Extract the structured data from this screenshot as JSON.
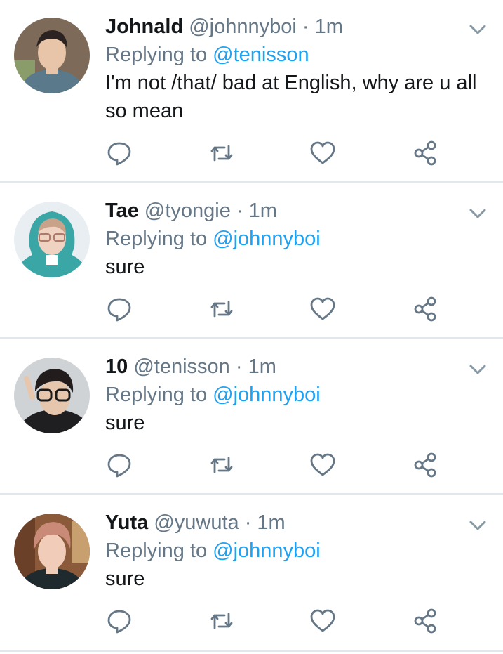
{
  "tweets": [
    {
      "name": "Johnald",
      "handle": "@johnnyboi",
      "sep": " · ",
      "time": "1m",
      "replying_prefix": "Replying to ",
      "replying_to": "@tenisson",
      "text_lines": [
        "I'm not /that/ bad at English, why are u all",
        "so mean"
      ],
      "avatar": {
        "skin": "#e8c4a8",
        "hair": "#2b2222",
        "shirt": "#5a7a8c",
        "bg": "#7d6a58"
      }
    },
    {
      "name": "Tae",
      "handle": "@tyongie",
      "sep": " · ",
      "time": "1m",
      "replying_prefix": "Replying to ",
      "replying_to": "@johnnyboi",
      "text_lines": [
        "sure"
      ],
      "avatar": {
        "skin": "#f0d2c2",
        "hair": "#c9a28a",
        "shirt": "#3aa6a6",
        "bg": "#e9eef2"
      }
    },
    {
      "name": "10",
      "handle": "@tenisson",
      "sep": " · ",
      "time": "1m",
      "replying_prefix": "Replying to ",
      "replying_to": "@johnnyboi",
      "text_lines": [
        "sure"
      ],
      "avatar": {
        "skin": "#e6c6ad",
        "hair": "#221c1c",
        "shirt": "#1f1f22",
        "bg": "#cfd3d6"
      }
    },
    {
      "name": "Yuta",
      "handle": "@yuwuta",
      "sep": " · ",
      "time": "1m",
      "replying_prefix": "Replying to ",
      "replying_to": "@johnnyboi",
      "text_lines": [
        "sure"
      ],
      "avatar": {
        "skin": "#f1cdb9",
        "hair": "#c98a78",
        "shirt": "#1e2a2e",
        "bg": "#8a5a3a"
      }
    }
  ],
  "icons": {
    "reply": "reply-icon",
    "retweet": "retweet-icon",
    "like": "heart-icon",
    "share": "share-icon",
    "more": "chevron-down-icon"
  },
  "colors": {
    "mention": "#1da1f2",
    "meta": "#657786",
    "text": "#14171a",
    "icon": "#657786",
    "divider": "#e1e8ed"
  }
}
